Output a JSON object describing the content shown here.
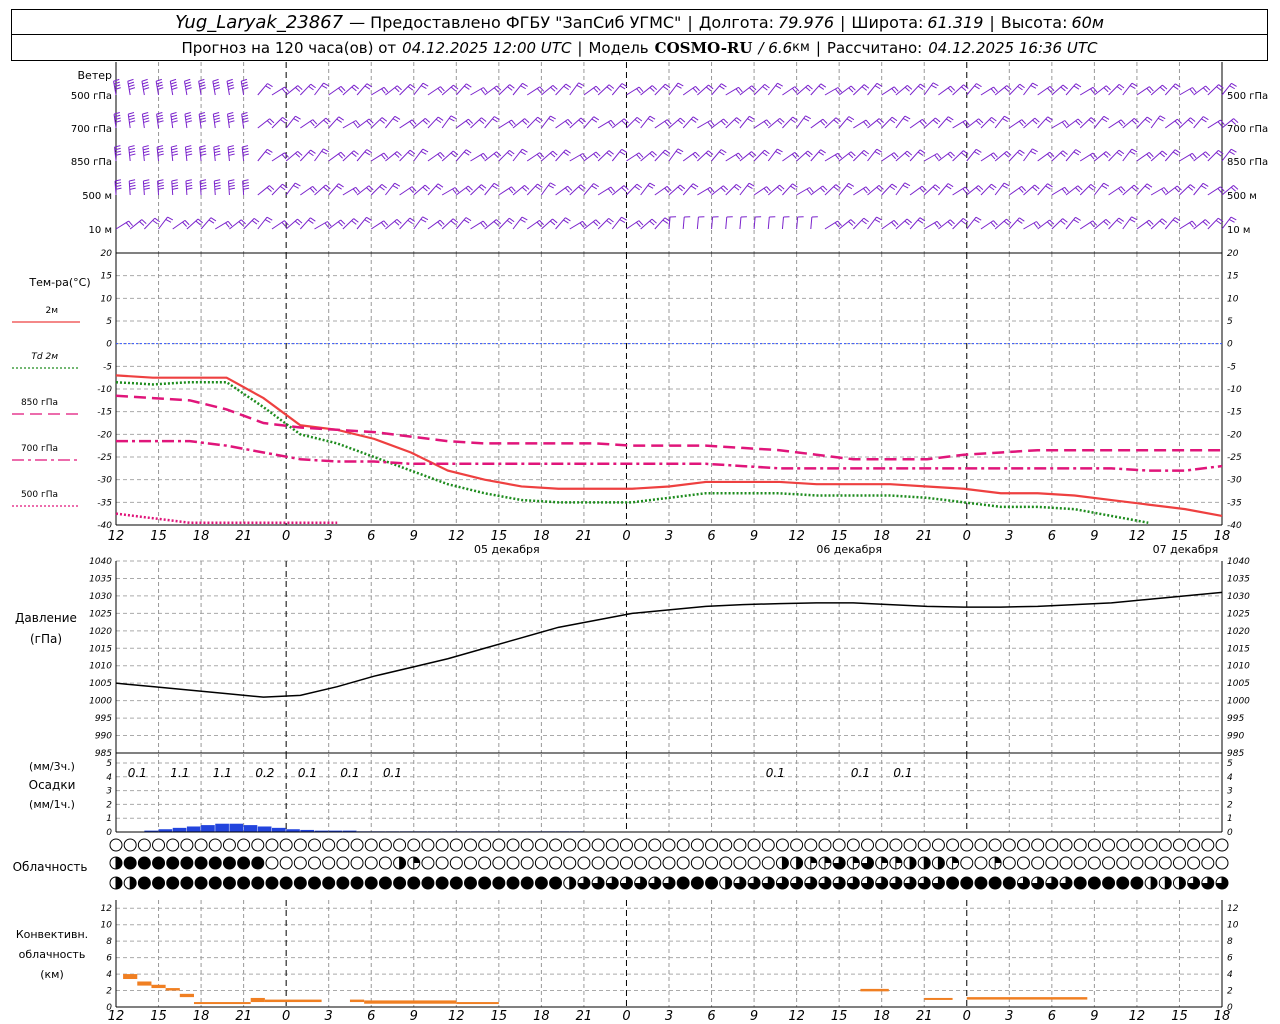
{
  "header": {
    "station": "Yug_Laryak_23867",
    "provider": "— Предоставлено ФГБУ \"ЗапСиб УГМС\"",
    "lon_label": "Долгота:",
    "lon": "79.976",
    "lat_label": "Широта:",
    "lat": "61.319",
    "alt_label": "Высота:",
    "alt": "60м",
    "forecast_label": "Прогноз на 120 часа(ов) от",
    "forecast_from": "04.12.2025 12:00 UTC",
    "model_label": "Модель",
    "model": "COSMO-RU",
    "model_res": "/ 6.6",
    "model_res_unit": "км",
    "calc_label": "Рассчитано:",
    "calc_time": "04.12.2025 16:36 UTC",
    "sep": "|"
  },
  "labels": {
    "wind": "Ветер",
    "wind_levels": [
      "500 гПа",
      "700 гПа",
      "850 гПа",
      "500 м",
      "10 м"
    ],
    "temp": "Тем-ра(°C)",
    "legend": [
      {
        "name": "2м",
        "color": "#ee4040",
        "dash": "solid"
      },
      {
        "name": "Td 2м",
        "color": "#1e8c1e",
        "dash": "dotted"
      },
      {
        "name": "850 гПа",
        "color": "#e0157a",
        "dash": "dash"
      },
      {
        "name": "700 гПа",
        "color": "#e0157a",
        "dash": "dashdot"
      },
      {
        "name": "500 гПа",
        "color": "#e0157a",
        "dash": "dotted"
      }
    ],
    "pressure": [
      "Давление",
      "(гПа)"
    ],
    "precip": [
      "(мм/3ч.)",
      "Осадки",
      "(мм/1ч.)"
    ],
    "cloud": "Облачность",
    "conv": [
      "Конвективн.",
      "облачность",
      "(км)"
    ]
  },
  "chart_data": [
    {
      "type": "line",
      "title": "Ветер",
      "levels": [
        "500 гПа",
        "700 гПа",
        "850 гПа",
        "500 м",
        "10 м"
      ],
      "color": "#7a22cc"
    },
    {
      "type": "line",
      "title": "Тем-ра(°C)",
      "x_hours": [
        0,
        3,
        6,
        9,
        12,
        15,
        18,
        21,
        24,
        27,
        30,
        33,
        36,
        39,
        42,
        45,
        48,
        51,
        54,
        57,
        60,
        63,
        66,
        69,
        72,
        75,
        78,
        81,
        84,
        87,
        90
      ],
      "ylim": [
        -40,
        20
      ],
      "yticks": [
        20,
        15,
        10,
        5,
        0,
        -5,
        -10,
        -15,
        -20,
        -25,
        -30,
        -35,
        -40
      ],
      "series": [
        {
          "name": "2м",
          "values": [
            -7,
            -7.5,
            -7.5,
            -7.5,
            -12,
            -18,
            -19,
            -21,
            -24,
            -28,
            -30,
            -31.5,
            -32,
            -32,
            -32,
            -31.5,
            -30.5,
            -30.5,
            -30.5,
            -31,
            -31,
            -31,
            -31.5,
            -32,
            -33,
            -33,
            -33.5,
            -34.5,
            -35.5,
            -36.5,
            -38
          ]
        },
        {
          "name": "Td 2м",
          "values": [
            -8.5,
            -9,
            -8.5,
            -8.5,
            -14,
            -20,
            -22,
            -25,
            -28,
            -31,
            -33,
            -34.5,
            -35,
            -35,
            -35,
            -34,
            -33,
            -33,
            -33,
            -33.5,
            -33.5,
            -33.5,
            -34,
            -35,
            -36,
            -36,
            -36.5,
            -38,
            -39.5,
            -41,
            -42
          ]
        },
        {
          "name": "850 гПа",
          "values": [
            -11.5,
            -12,
            -12.5,
            -14.5,
            -17.5,
            -18.5,
            -19,
            -19.5,
            -20.5,
            -21.5,
            -22,
            -22,
            -22,
            -22,
            -22.5,
            -22.5,
            -22.5,
            -23,
            -23.5,
            -24.5,
            -25.5,
            -25.5,
            -25.5,
            -24.5,
            -24,
            -23.5,
            -23.5,
            -23.5,
            -23.5,
            -23.5,
            -23.5
          ]
        },
        {
          "name": "700 гПа",
          "values": [
            -21.5,
            -21.5,
            -21.5,
            -22.5,
            -24,
            -25.5,
            -26,
            -26,
            -26.5,
            -26.5,
            -26.5,
            -26.5,
            -26.5,
            -26.5,
            -26.5,
            -26.5,
            -26.5,
            -27,
            -27.5,
            -27.5,
            -27.5,
            -27.5,
            -27.5,
            -27.5,
            -27.5,
            -27.5,
            -27.5,
            -27.5,
            -28,
            -28,
            -27
          ]
        },
        {
          "name": "500 гПа",
          "values": [
            -37.5,
            -38.5,
            -39.5,
            -40.5,
            -40.5,
            -40.5,
            -39.5,
            -40.5,
            -40.5,
            -40.5,
            -40.5,
            -40.5,
            -40.5,
            -40.5,
            -40.5,
            -40.5,
            -40.5,
            -40.5,
            -40.5,
            -40.5,
            -40.5,
            -40.5,
            -40.5,
            -40.5,
            -40.5,
            -40.5,
            -40.5,
            -40.5,
            -40.5,
            -40.5,
            -40.5
          ]
        }
      ]
    },
    {
      "type": "line",
      "title": "Давление",
      "ylabel": "(гПа)",
      "ylim": [
        985,
        1040
      ],
      "yticks": [
        1040,
        1035,
        1030,
        1025,
        1020,
        1015,
        1010,
        1005,
        1000,
        995,
        990,
        985
      ],
      "x_hours": [
        0,
        3,
        6,
        9,
        12,
        15,
        18,
        21,
        24,
        27,
        30,
        33,
        36,
        39,
        42,
        45,
        48,
        51,
        54,
        57,
        60,
        63,
        66,
        69,
        72,
        75,
        78,
        81,
        84,
        87,
        90
      ],
      "values": [
        1005,
        1004,
        1003,
        1002,
        1001,
        1001.5,
        1004,
        1007,
        1009.5,
        1012,
        1015,
        1018,
        1021,
        1023,
        1025,
        1026,
        1027,
        1027.5,
        1027.8,
        1028,
        1028,
        1027.5,
        1027,
        1026.8,
        1026.8,
        1027,
        1027.5,
        1028,
        1029,
        1030,
        1031
      ]
    },
    {
      "type": "bar",
      "title": "Осадки",
      "ylim": [
        0,
        5
      ],
      "yticks": [
        5,
        4,
        3,
        2,
        1,
        0
      ],
      "labels_3h": [
        {
          "hour": 1.5,
          "text": "0.1"
        },
        {
          "hour": 4.5,
          "text": "1.1"
        },
        {
          "hour": 7.5,
          "text": "1.1"
        },
        {
          "hour": 10.5,
          "text": "0.2"
        },
        {
          "hour": 13.5,
          "text": "0.1"
        },
        {
          "hour": 16.5,
          "text": "0.1"
        },
        {
          "hour": 19.5,
          "text": "0.1"
        },
        {
          "hour": 46.5,
          "text": "0.1"
        },
        {
          "hour": 52.5,
          "text": "0.1"
        },
        {
          "hour": 55.5,
          "text": "0.1"
        }
      ],
      "hourly": [
        0,
        0,
        0.1,
        0.2,
        0.3,
        0.4,
        0.5,
        0.6,
        0.6,
        0.5,
        0.4,
        0.3,
        0.2,
        0.15,
        0.1,
        0.1,
        0.1,
        0.05,
        0.05,
        0.05,
        0.05,
        0.05,
        0.05,
        0.05,
        0.05,
        0.05,
        0.05,
        0.05,
        0.05,
        0.05,
        0.05,
        0.05,
        0.05,
        0,
        0,
        0,
        0,
        0,
        0,
        0,
        0,
        0,
        0,
        0,
        0,
        0,
        0,
        0,
        0,
        0,
        0,
        0,
        0,
        0,
        0,
        0,
        0,
        0,
        0,
        0,
        0,
        0,
        0,
        0,
        0,
        0,
        0,
        0,
        0,
        0,
        0,
        0,
        0,
        0,
        0,
        0,
        0,
        0,
        0,
        0
      ]
    },
    {
      "type": "bar",
      "title": "Конвективн. облачность (км)",
      "ylim": [
        0,
        13
      ],
      "yticks": [
        12,
        10,
        8,
        6,
        4,
        2,
        0
      ],
      "segments": [
        {
          "from": 0.5,
          "to": 1.5,
          "base": 3.4,
          "top": 4.0
        },
        {
          "from": 1.5,
          "to": 2.5,
          "base": 2.6,
          "top": 3.1
        },
        {
          "from": 2.5,
          "to": 3.5,
          "base": 2.3,
          "top": 2.7
        },
        {
          "from": 3.5,
          "to": 4.5,
          "base": 2.0,
          "top": 2.3
        },
        {
          "from": 4.5,
          "to": 5.5,
          "base": 1.2,
          "top": 1.6
        },
        {
          "from": 5.5,
          "to": 9.5,
          "base": 0.4,
          "top": 0.6
        },
        {
          "from": 9.5,
          "to": 10.5,
          "base": 0.6,
          "top": 1.1
        },
        {
          "from": 10.5,
          "to": 14.5,
          "base": 0.6,
          "top": 0.9
        },
        {
          "from": 16.5,
          "to": 17.5,
          "base": 0.6,
          "top": 0.9
        },
        {
          "from": 17.5,
          "to": 24,
          "base": 0.4,
          "top": 0.8
        },
        {
          "from": 24,
          "to": 27,
          "base": 0.4,
          "top": 0.6
        },
        {
          "from": 52.5,
          "to": 54.5,
          "base": 1.9,
          "top": 2.2
        },
        {
          "from": 57,
          "to": 59,
          "base": 0.9,
          "top": 1.1
        },
        {
          "from": 60,
          "to": 68.5,
          "base": 0.9,
          "top": 1.2
        }
      ]
    }
  ],
  "axis": {
    "x_ticks": [
      "12",
      "15",
      "18",
      "21",
      "0",
      "3",
      "6",
      "9",
      "12",
      "15",
      "18",
      "21",
      "0",
      "3",
      "6",
      "9",
      "12",
      "15",
      "18",
      "21",
      "0",
      "3",
      "6",
      "9",
      "12",
      "15",
      "18"
    ],
    "dates": [
      "05 декабря",
      "06 декабря",
      "07 декабря"
    ]
  },
  "cloud_rows": {
    "top": "oooooooooooooooooooooooooooooooooooooooooooooooooooooooooooooooooooooooooooooooooooo",
    "mid": "hffffffffffooooooooohqooooooooooooooooooooooooohhqqtqtqqhhhqooqoooooooooooooooooooooqqh",
    "low": "hhffffffffffffffffffffffffffffffhtttttttfffhtttttttttttttttfffffttttfffffhhhtttttttttt"
  }
}
